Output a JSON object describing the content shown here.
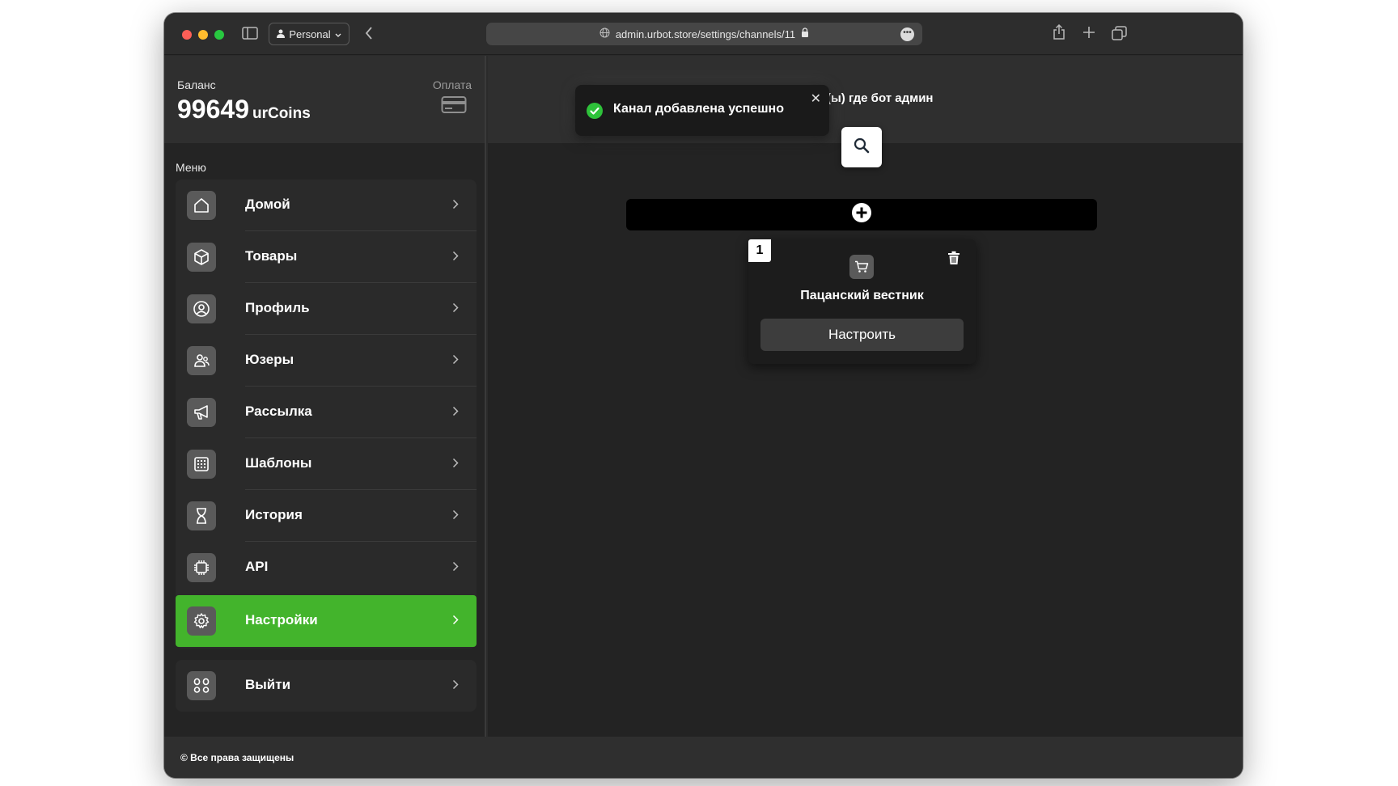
{
  "browser": {
    "profile": "Personal",
    "url": "admin.urbot.store/settings/channels/11"
  },
  "balance": {
    "label": "Баланс",
    "amount": "99649",
    "unit": "urCoins",
    "pay_label": "Оплата"
  },
  "menu": {
    "label": "Меню",
    "items": [
      {
        "label": "Домой",
        "icon": "home-icon"
      },
      {
        "label": "Товары",
        "icon": "box-icon"
      },
      {
        "label": "Профиль",
        "icon": "user-circle-icon"
      },
      {
        "label": "Юзеры",
        "icon": "users-icon"
      },
      {
        "label": "Рассылка",
        "icon": "megaphone-icon"
      },
      {
        "label": "Шаблоны",
        "icon": "grid-icon"
      },
      {
        "label": "История",
        "icon": "hourglass-icon"
      },
      {
        "label": "API",
        "icon": "chip-icon"
      },
      {
        "label": "Настройки",
        "icon": "gear-icon"
      }
    ],
    "active_index": 8,
    "logout": {
      "label": "Выйти",
      "icon": "logout-icon"
    }
  },
  "footer": {
    "text": "© Все права защищены"
  },
  "main": {
    "hint": "(ы) где бот админ",
    "card": {
      "number": "1",
      "title": "Пацанский вестник",
      "button": "Настроить"
    }
  },
  "toast": {
    "message": "Канал добавлена успешно"
  },
  "colors": {
    "accent": "#43b42c",
    "success": "#2ec23a"
  }
}
